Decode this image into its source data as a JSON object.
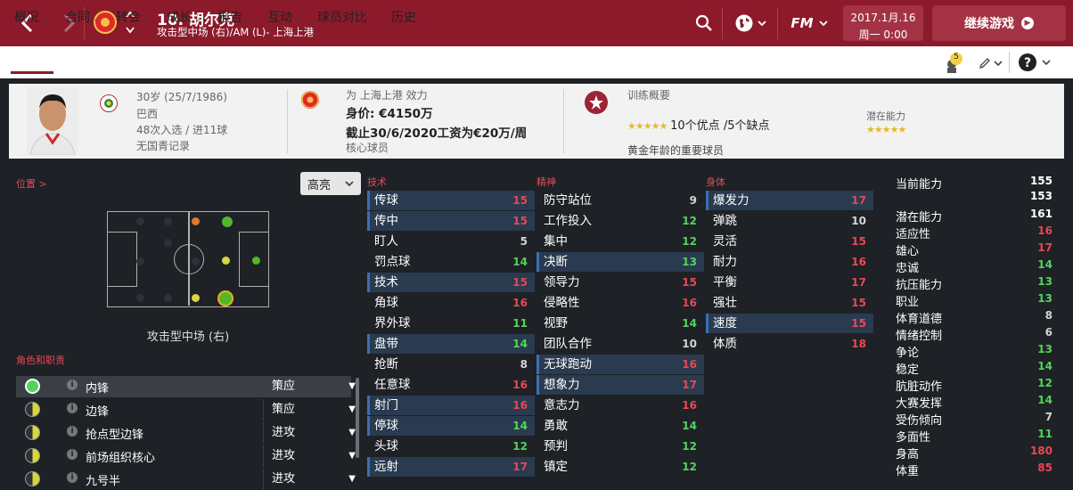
{
  "header": {
    "player_name": "10. 胡尔克",
    "player_sub": "攻击型中场 (右)/AM (L)- 上海上港",
    "date_line1": "2017.1月.16",
    "date_line2": "周一 0:00",
    "continue_label": "继续游戏",
    "fm_label": "FM"
  },
  "menu": {
    "items": [
      "概况",
      "合同",
      "转会",
      "成长",
      "报告",
      "互动",
      "球员对比",
      "历史"
    ],
    "notification_count": "5"
  },
  "info": {
    "age": "30岁 (25/7/1986)",
    "nation": "巴西",
    "caps": "48次入选 / 进11球",
    "youth": "无国青记录",
    "club_line": "为 上海上港 效力",
    "value": "身价: €4150万",
    "contract": "截止30/6/2020工资为€20万/周",
    "squad_status": "核心球员",
    "training_title": "训练概要",
    "training_text": "10个优点 /5个缺点",
    "potential_label": "潜在能力",
    "age_status": "黄金年龄的重要球员"
  },
  "left": {
    "position_label": "位置 >",
    "highlight_label": "高亮",
    "position_name": "攻击型中场 (右)",
    "roles_label": "角色和职责",
    "roles": [
      {
        "name": "内锋",
        "duty": "策应"
      },
      {
        "name": "边锋",
        "duty": "策应"
      },
      {
        "name": "抢点型边锋",
        "duty": "进攻"
      },
      {
        "name": "前场组织核心",
        "duty": "进攻"
      },
      {
        "name": "九号半",
        "duty": "进攻"
      }
    ]
  },
  "attributes": {
    "technical_label": "技术",
    "mental_label": "精神",
    "physical_label": "身体",
    "technical": [
      {
        "name": "传球",
        "value": "15"
      },
      {
        "name": "传中",
        "value": "15"
      },
      {
        "name": "盯人",
        "value": "5"
      },
      {
        "name": "罚点球",
        "value": "14"
      },
      {
        "name": "技术",
        "value": "15"
      },
      {
        "name": "角球",
        "value": "16"
      },
      {
        "name": "界外球",
        "value": "11"
      },
      {
        "name": "盘带",
        "value": "14"
      },
      {
        "name": "抢断",
        "value": "8"
      },
      {
        "name": "任意球",
        "value": "16"
      },
      {
        "name": "射门",
        "value": "16"
      },
      {
        "name": "停球",
        "value": "14"
      },
      {
        "name": "头球",
        "value": "12"
      },
      {
        "name": "远射",
        "value": "17"
      }
    ],
    "mental": [
      {
        "name": "防守站位",
        "value": "9"
      },
      {
        "name": "工作投入",
        "value": "12"
      },
      {
        "name": "集中",
        "value": "12"
      },
      {
        "name": "决断",
        "value": "13"
      },
      {
        "name": "领导力",
        "value": "15"
      },
      {
        "name": "侵略性",
        "value": "16"
      },
      {
        "name": "视野",
        "value": "14"
      },
      {
        "name": "团队合作",
        "value": "10"
      },
      {
        "name": "无球跑动",
        "value": "16"
      },
      {
        "name": "想象力",
        "value": "17"
      },
      {
        "name": "意志力",
        "value": "16"
      },
      {
        "name": "勇敢",
        "value": "14"
      },
      {
        "name": "预判",
        "value": "12"
      },
      {
        "name": "镇定",
        "value": "12"
      }
    ],
    "physical": [
      {
        "name": "爆发力",
        "value": "17"
      },
      {
        "name": "弹跳",
        "value": "10"
      },
      {
        "name": "灵活",
        "value": "15"
      },
      {
        "name": "耐力",
        "value": "16"
      },
      {
        "name": "平衡",
        "value": "17"
      },
      {
        "name": "强壮",
        "value": "15"
      },
      {
        "name": "速度",
        "value": "15"
      },
      {
        "name": "体质",
        "value": "18"
      }
    ]
  },
  "right": {
    "current_ability_label": "当前能力",
    "current_ability_values": [
      "155",
      "153"
    ],
    "rows": [
      {
        "name": "潜在能力",
        "value": "161"
      },
      {
        "name": "适应性",
        "value": "16"
      },
      {
        "name": "雄心",
        "value": "17"
      },
      {
        "name": "忠诚",
        "value": "14"
      },
      {
        "name": "抗压能力",
        "value": "13"
      },
      {
        "name": "职业",
        "value": "13"
      },
      {
        "name": "体育道德",
        "value": "8"
      },
      {
        "name": "情绪控制",
        "value": "6"
      },
      {
        "name": "争论",
        "value": "13"
      },
      {
        "name": "稳定",
        "value": "14"
      },
      {
        "name": "肮脏动作",
        "value": "12"
      },
      {
        "name": "大赛发挥",
        "value": "14"
      },
      {
        "name": "受伤倾向",
        "value": "7"
      },
      {
        "name": "多面性",
        "value": "11"
      },
      {
        "name": "身高",
        "value": "180"
      },
      {
        "name": "体重",
        "value": "85"
      }
    ]
  },
  "colors": {
    "brand_red": "#8c1a2b",
    "high": "#e84855",
    "mid": "#52d45a",
    "low": "#d4d4d4"
  }
}
